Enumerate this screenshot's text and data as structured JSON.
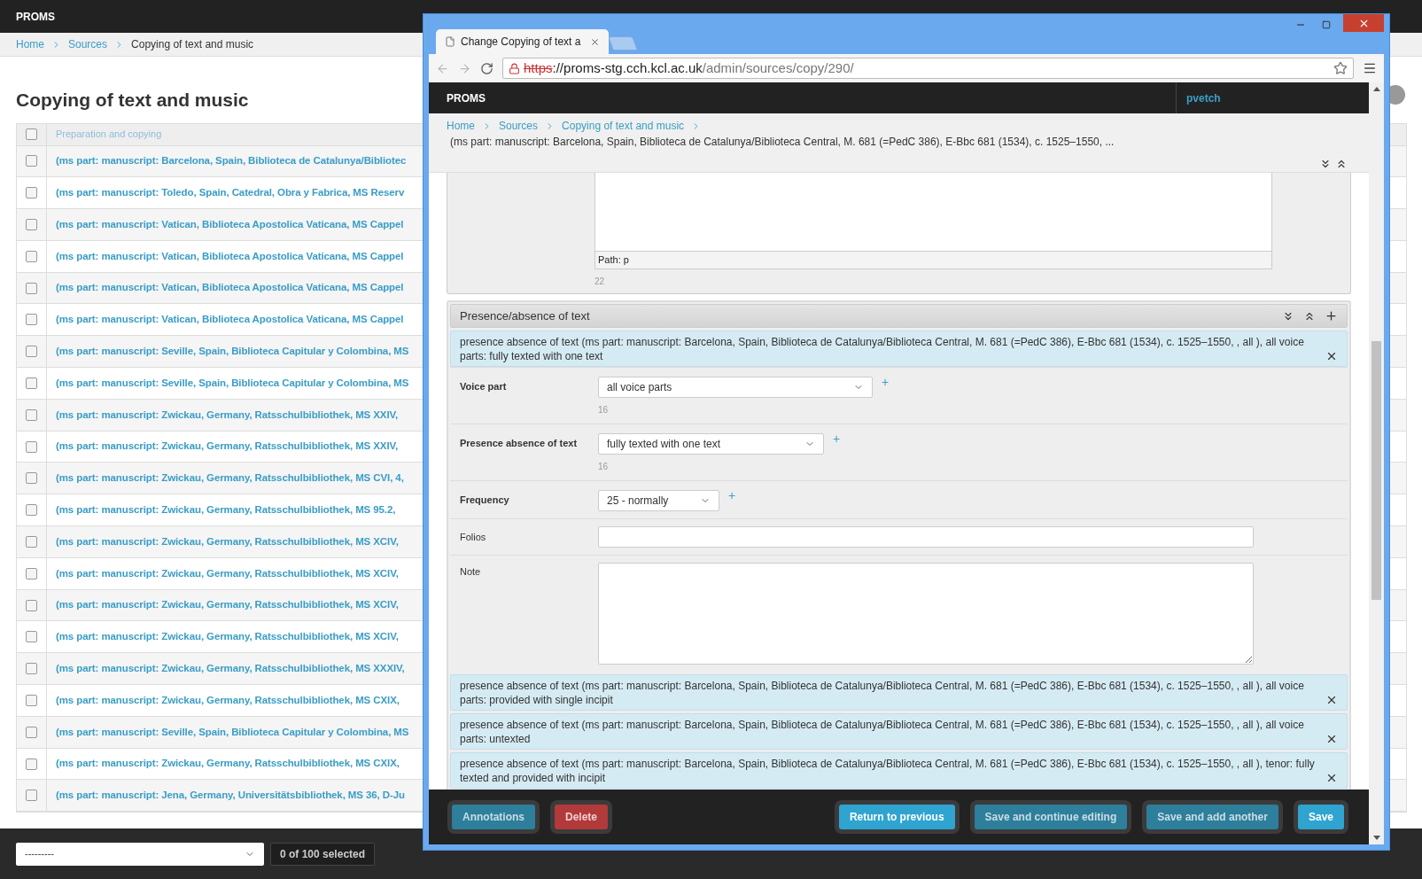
{
  "background_page": {
    "brand": "PROMS",
    "breadcrumb": [
      {
        "label": "Home"
      },
      {
        "label": "Sources"
      }
    ],
    "current": "Copying of text and music",
    "title": "Copying of text and music",
    "table": {
      "all_checked": false,
      "column": "Preparation and copying",
      "rows": [
        {
          "text": "(ms part: manuscript: Barcelona, Spain, Biblioteca de Catalunya/Bibliotec",
          "checked": false
        },
        {
          "text": "(ms part: manuscript: Toledo, Spain, Catedral, Obra y Fabrica, MS Reserv",
          "checked": false
        },
        {
          "text": "(ms part: manuscript: Vatican, Biblioteca Apostolica Vaticana, MS Cappel",
          "checked": false
        },
        {
          "text": "(ms part: manuscript: Vatican, Biblioteca Apostolica Vaticana, MS Cappel",
          "checked": false
        },
        {
          "text": "(ms part: manuscript: Vatican, Biblioteca Apostolica Vaticana, MS Cappel",
          "checked": false
        },
        {
          "text": "(ms part: manuscript: Vatican, Biblioteca Apostolica Vaticana, MS Cappel",
          "checked": false
        },
        {
          "text": "(ms part: manuscript: Seville, Spain, Biblioteca Capitular y Colombina, MS",
          "checked": false
        },
        {
          "text": "(ms part: manuscript: Seville, Spain, Biblioteca Capitular y Colombina, MS",
          "checked": false
        },
        {
          "text": "(ms part: manuscript: Zwickau, Germany, Ratsschulbibliothek, MS XXIV,",
          "checked": false
        },
        {
          "text": "(ms part: manuscript: Zwickau, Germany, Ratsschulbibliothek, MS XXIV,",
          "checked": false
        },
        {
          "text": "(ms part: manuscript: Zwickau, Germany, Ratsschulbibliothek, MS CVI, 4,",
          "checked": false
        },
        {
          "text": "(ms part: manuscript: Zwickau, Germany, Ratsschulbibliothek, MS 95.2,",
          "checked": false
        },
        {
          "text": "(ms part: manuscript: Zwickau, Germany, Ratsschulbibliothek, MS XCIV,",
          "checked": false
        },
        {
          "text": "(ms part: manuscript: Zwickau, Germany, Ratsschulbibliothek, MS XCIV,",
          "checked": false
        },
        {
          "text": "(ms part: manuscript: Zwickau, Germany, Ratsschulbibliothek, MS XCIV,",
          "checked": false
        },
        {
          "text": "(ms part: manuscript: Zwickau, Germany, Ratsschulbibliothek, MS XCIV,",
          "checked": false
        },
        {
          "text": "(ms part: manuscript: Zwickau, Germany, Ratsschulbibliothek, MS XXXIV,",
          "checked": false
        },
        {
          "text": "(ms part: manuscript: Zwickau, Germany, Ratsschulbibliothek, MS CXIX,",
          "checked": false
        },
        {
          "text": "(ms part: manuscript: Seville, Spain, Biblioteca Capitular y Colombina, MS",
          "checked": false
        },
        {
          "text": "(ms part: manuscript: Zwickau, Germany, Ratsschulbibliothek, MS CXIX,",
          "checked": false
        },
        {
          "text": "(ms part: manuscript: Jena, Germany, Universitätsbibliothek, MS 36, D-Ju",
          "checked": false
        }
      ]
    },
    "action_select": "---------",
    "selection_count": "0 of 100 selected"
  },
  "browser": {
    "tab_title": "Change Copying of text a",
    "url_scheme": "https",
    "url_host": "://proms-stg.cch.kcl.ac.uk",
    "url_path": "/admin/sources/copy/290/",
    "site": {
      "brand": "PROMS",
      "user": "pvetch",
      "breadcrumb": [
        {
          "label": "Home"
        },
        {
          "label": "Sources"
        },
        {
          "label": "Copying of text and music"
        }
      ],
      "record": "(ms part: manuscript: Barcelona, Spain, Biblioteca de Catalunya/Biblioteca Central, M. 681 (=PedC 386), E-Bbc 681 (1534), c. 1525–1550, ..."
    },
    "editor": {
      "path": "Path: p",
      "count": "22"
    },
    "fieldset": {
      "title": "Presence/absence of text",
      "items": [
        {
          "title": "presence absence of text  (ms part: manuscript: Barcelona, Spain, Biblioteca de Catalunya/Biblioteca Central, M. 681 (=PedC 386), E-Bbc 681 (1534), c. 1525–1550, , all ), all voice parts: fully texted with one text",
          "fields": [
            {
              "kind": "select",
              "label": "Voice part",
              "required": true,
              "value": "all voice parts",
              "count": "16",
              "add": "+"
            },
            {
              "kind": "select",
              "label": "Presence absence of text",
              "required": true,
              "value": "fully texted with one text",
              "count": "16",
              "add": "+"
            },
            {
              "kind": "select",
              "label": "Frequency",
              "required": true,
              "value": "25 - normally",
              "add": "+"
            },
            {
              "kind": "input",
              "label": "Folios",
              "required": false
            },
            {
              "kind": "textarea",
              "label": "Note",
              "required": false
            }
          ]
        },
        {
          "title": "presence absence of text  (ms part: manuscript: Barcelona, Spain, Biblioteca de Catalunya/Biblioteca Central, M. 681 (=PedC 386), E-Bbc 681 (1534), c. 1525–1550, , all ), all voice parts: provided with single incipit"
        },
        {
          "title": "presence absence of text  (ms part: manuscript: Barcelona, Spain, Biblioteca de Catalunya/Biblioteca Central, M. 681 (=PedC 386), E-Bbc 681 (1534), c. 1525–1550, , all ), all voice parts: untexted"
        },
        {
          "title": "presence absence of text  (ms part: manuscript: Barcelona, Spain, Biblioteca de Catalunya/Biblioteca Central, M. 681 (=PedC 386), E-Bbc 681 (1534), c. 1525–1550, , all ), tenor: fully texted and provided with incipit"
        }
      ]
    },
    "buttons_left": [
      {
        "label": "Annotations",
        "kind": "secondary"
      },
      {
        "label": "Delete",
        "kind": "danger"
      }
    ],
    "buttons_right": [
      {
        "label": "Return to previous",
        "kind": "primary"
      },
      {
        "label": "Save and continue editing",
        "kind": "secondary"
      },
      {
        "label": "Save and add another",
        "kind": "secondary"
      },
      {
        "label": "Save",
        "kind": "primary"
      }
    ]
  }
}
